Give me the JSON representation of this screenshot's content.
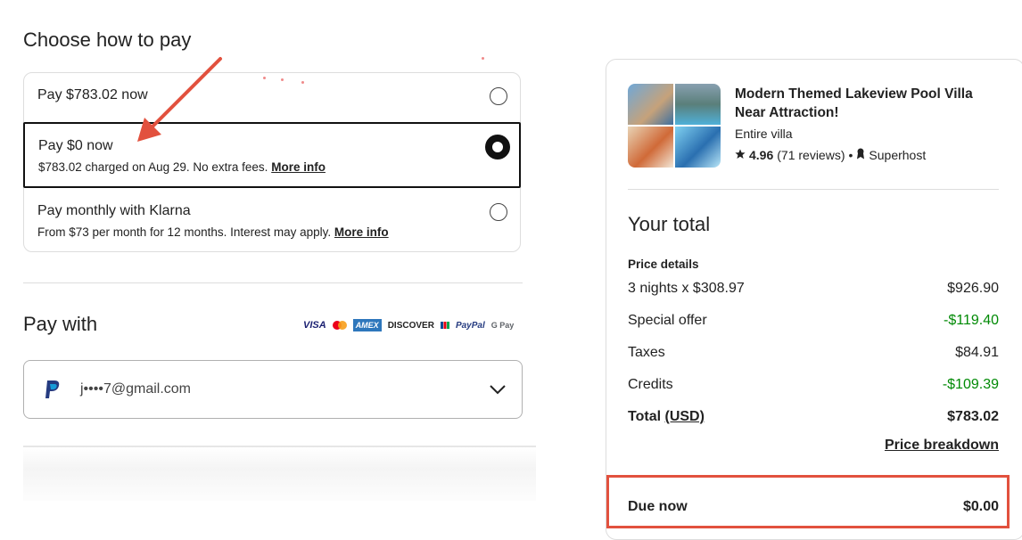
{
  "left": {
    "choose_title": "Choose how to pay",
    "options": [
      {
        "label": "Pay $783.02 now",
        "detail": "",
        "link": ""
      },
      {
        "label": "Pay $0 now",
        "detail": "$783.02 charged on Aug 29. No extra fees.",
        "link": "More info"
      },
      {
        "label": "Pay monthly with Klarna",
        "detail": "From $73 per month for 12 months. Interest may apply.",
        "link": "More info"
      }
    ],
    "pay_with_title": "Pay with",
    "card_logos": {
      "visa": "VISA",
      "amex": "AMEX",
      "discover": "DISCOVER",
      "paypal": "PayPal",
      "gpay": "G Pay"
    },
    "payment_method": {
      "value": "j••••7@gmail.com",
      "icon": "paypal-icon"
    }
  },
  "summary": {
    "listing": {
      "title": "Modern Themed Lakeview Pool Villa Near Attraction!",
      "type": "Entire villa",
      "rating": "4.96",
      "reviews": "(71 reviews)",
      "separator": "•",
      "badge": "Superhost"
    },
    "total_title": "Your total",
    "price_details_label": "Price details",
    "rows": [
      {
        "label": "3 nights x $308.97",
        "value": "$926.90"
      },
      {
        "label": "Special offer",
        "value": "-$119.40"
      },
      {
        "label": "Taxes",
        "value": "$84.91"
      },
      {
        "label": "Credits",
        "value": "-$109.39"
      }
    ],
    "total_label": "Total",
    "total_currency": "(USD)",
    "total_value": "$783.02",
    "breakdown_link": "Price breakdown",
    "due_now_label": "Due now",
    "due_now_value": "$0.00"
  },
  "colors": {
    "accent_annotation": "#e2513e",
    "discount_green": "#008a05",
    "text": "#222222",
    "border": "#dddddd"
  }
}
